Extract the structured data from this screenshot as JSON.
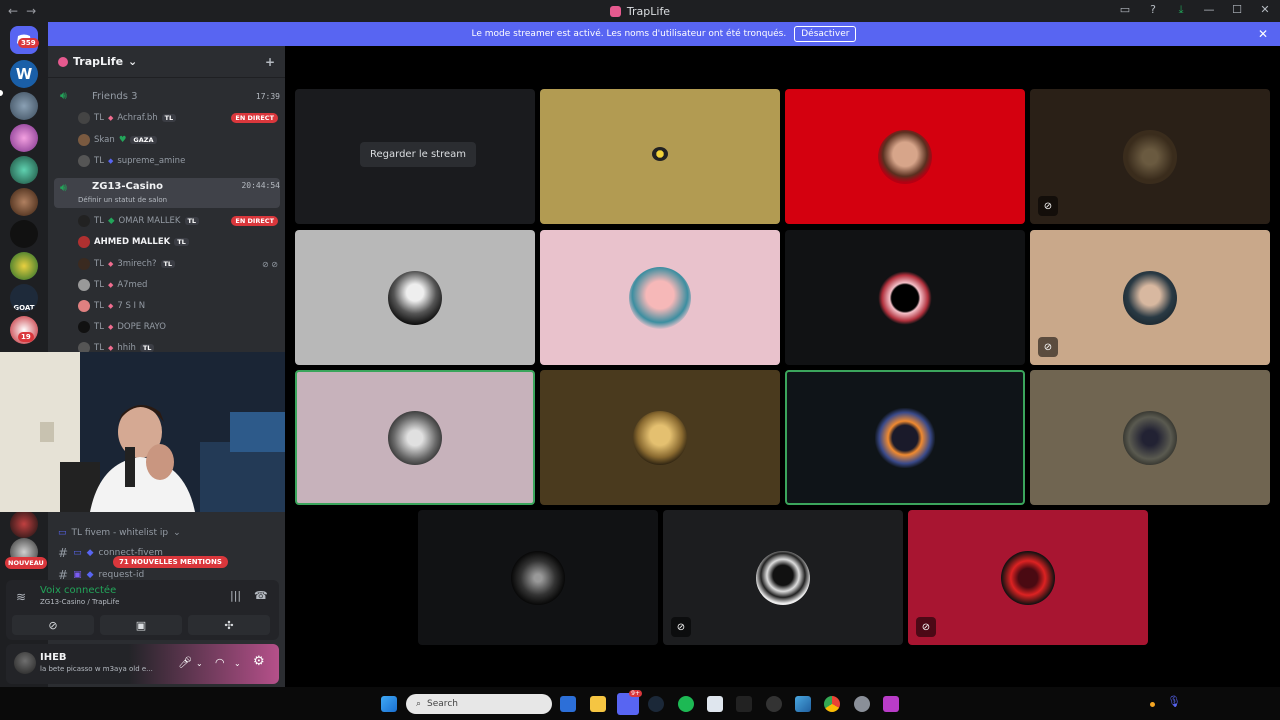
{
  "window": {
    "title": "TrapLife",
    "nav_back": "←",
    "nav_forward": "→",
    "controls": [
      "▭",
      "?",
      "⤓",
      "—",
      "☐",
      "✕"
    ]
  },
  "banner": {
    "text": "Le mode streamer est activé. Les noms d'utilisateur ont été tronqués.",
    "button": "Désactiver",
    "close": "✕"
  },
  "guilds": {
    "home_badge": "359",
    "badge_19": "19",
    "nouveau": "NOUVEAU",
    "goat_label": "GOAT",
    "w_label": "W"
  },
  "server": {
    "name": "TrapLife",
    "chevron": "⌄",
    "add_user_icon": "+"
  },
  "voice_channels": [
    {
      "name": "Friends 3",
      "time": "17:39",
      "members": [
        {
          "prefix": "TL",
          "name": "Achraf.bh",
          "tag": "TL",
          "live": "EN DIRECT"
        },
        {
          "prefix": "Skan",
          "name": "",
          "tag": "GAZA",
          "live": ""
        },
        {
          "prefix": "TL",
          "name": "supreme_amine",
          "tag": "",
          "live": ""
        }
      ]
    },
    {
      "name": "ZG13-Casino",
      "time": "20:44:54",
      "status": "Définir un statut de salon",
      "members": [
        {
          "prefix": "TL",
          "name": "OMAR MALLEK",
          "tag": "TL",
          "live": "EN DIRECT"
        },
        {
          "prefix": "",
          "name": "AHMED MALLEK",
          "tag": "TL",
          "live": ""
        },
        {
          "prefix": "TL",
          "name": "3mirech?",
          "tag": "TL",
          "live": ""
        },
        {
          "prefix": "TL",
          "name": "A7med",
          "tag": "",
          "live": ""
        },
        {
          "prefix": "TL",
          "name": "7 S I N",
          "tag": "",
          "live": ""
        },
        {
          "prefix": "TL",
          "name": "DOPE RAYO",
          "tag": "",
          "live": ""
        },
        {
          "prefix": "TL",
          "name": "hhih",
          "tag": "TL",
          "live": ""
        }
      ]
    }
  ],
  "text_channels": {
    "category": "TL fivem - whitelist ip",
    "items": [
      "connect-fivem",
      "request-id"
    ],
    "mentions": "71 NOUVELLES MENTIONS"
  },
  "voice_status": {
    "label": "Voix connectée",
    "channel": "ZG13-Casino / TrapLife"
  },
  "user": {
    "name": "IHEB",
    "status": "la bete picasso w m3aya old e..."
  },
  "stage": {
    "watch_stream": "Regarder le stream"
  },
  "taskbar": {
    "search_placeholder": "Search",
    "discord_badge": "9+"
  },
  "colors": {
    "banner": "#5865f2",
    "live": "#da373c",
    "voice_green": "#23a55a",
    "sidebar": "#2b2d31",
    "guilds": "#1e1f22"
  }
}
